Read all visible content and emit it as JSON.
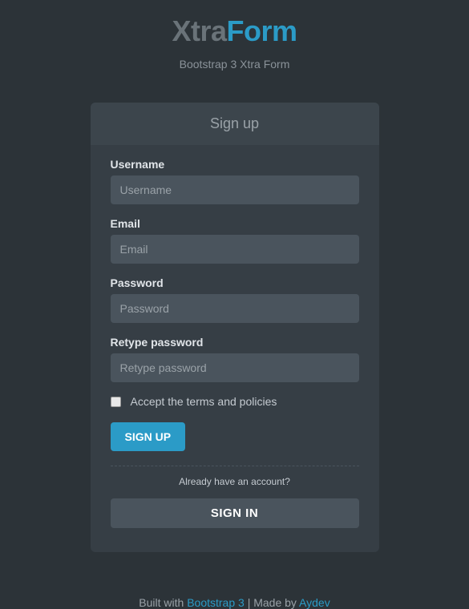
{
  "header": {
    "logo_prefix": "Xtra",
    "logo_suffix": "Form",
    "subtitle": "Bootstrap 3 Xtra Form"
  },
  "panel": {
    "heading": "Sign up"
  },
  "form": {
    "username": {
      "label": "Username",
      "placeholder": "Username",
      "value": ""
    },
    "email": {
      "label": "Email",
      "placeholder": "Email",
      "value": ""
    },
    "password": {
      "label": "Password",
      "placeholder": "Password",
      "value": ""
    },
    "retype": {
      "label": "Retype password",
      "placeholder": "Retype password",
      "value": ""
    },
    "terms": {
      "label": "Accept the terms and policies"
    },
    "signup_button": "SIGN UP",
    "already_text": "Already have an account?",
    "signin_button": "SIGN IN"
  },
  "footer": {
    "built_with": "Built with ",
    "bootstrap_link": "Bootstrap 3",
    "separator": " | Made by ",
    "author_link": "Aydev"
  }
}
